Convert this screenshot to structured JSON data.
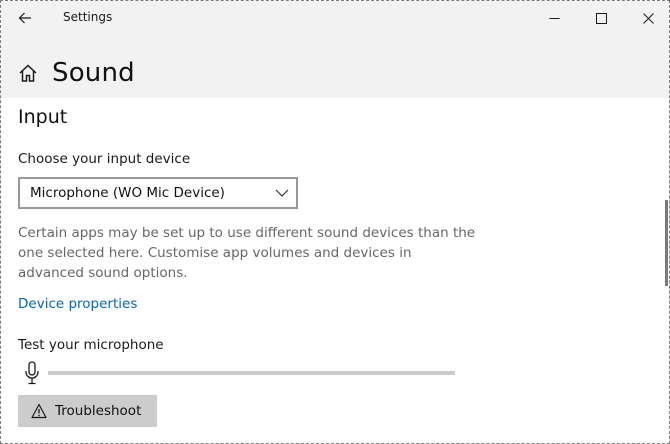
{
  "window": {
    "app_title": "Settings"
  },
  "header": {
    "page_title": "Sound"
  },
  "input_section": {
    "title": "Input",
    "device_label": "Choose your input device",
    "selected_device": "Microphone (WO Mic Device)",
    "description": "Certain apps may be set up to use different sound devices than the one selected here. Customise app volumes and devices in advanced sound options.",
    "device_properties_link": "Device properties",
    "test_label": "Test your microphone",
    "mic_level_fraction": 0,
    "troubleshoot_label": "Troubleshoot"
  },
  "icons": {
    "back": "back-arrow-icon",
    "home": "home-icon",
    "minimize": "minimize-icon",
    "maximize": "maximize-icon",
    "close": "close-icon",
    "dropdown": "chevron-down-icon",
    "microphone": "microphone-icon",
    "warning": "warning-icon"
  },
  "colors": {
    "header_bg": "#f2f2f2",
    "link": "#0067c0",
    "button_bg": "#cccccc",
    "secondary_text": "#666666"
  }
}
